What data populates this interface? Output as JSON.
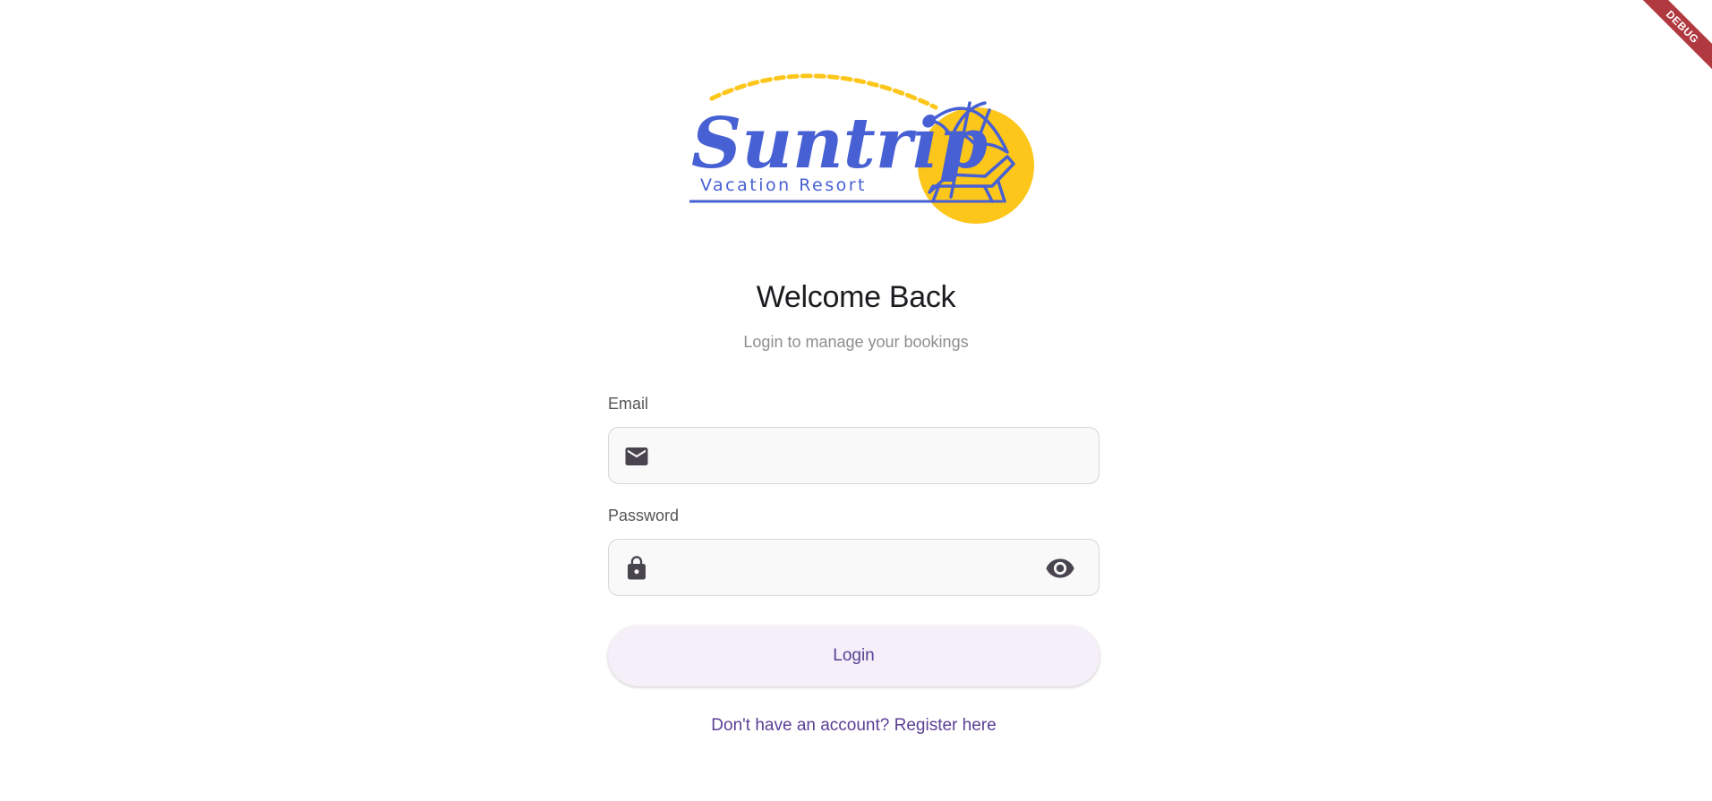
{
  "debug_banner": "DEBUG",
  "logo": {
    "brand": "Suntrip",
    "tagline": "Vacation Resort",
    "brand_color": "#4760d3",
    "sun_color": "#fdc61a"
  },
  "header": {
    "title": "Welcome Back",
    "subtitle": "Login to manage your bookings"
  },
  "form": {
    "email_label": "Email",
    "email_value": "",
    "password_label": "Password",
    "password_value": "",
    "login_label": "Login",
    "register_link": "Don't have an account? Register here"
  },
  "icons": {
    "email": "mail-icon",
    "password": "lock-icon",
    "toggle": "eye-icon"
  },
  "colors": {
    "accent": "#5a3f94",
    "button_bg": "#f4eff8",
    "debug_ribbon": "#b0383f"
  }
}
